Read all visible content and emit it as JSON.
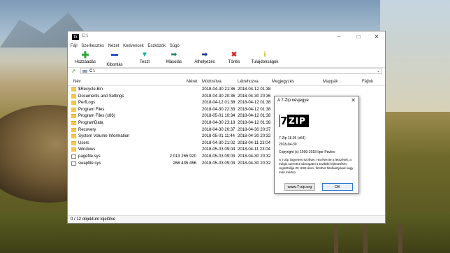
{
  "window": {
    "title": "C:\\",
    "app_icon_text": "7z"
  },
  "menu": [
    "Fájl",
    "Szerkesztés",
    "Nézet",
    "Kedvencek",
    "Eszközök",
    "Súgó"
  ],
  "toolbar": [
    {
      "label": "Hozzáadás",
      "icon": "plus-icon",
      "color": "#2fa93a"
    },
    {
      "label": "Kibontás",
      "icon": "minus-icon",
      "color": "#2b55c9"
    },
    {
      "label": "Teszt",
      "icon": "check-icon",
      "color": "#1aa7a1"
    },
    {
      "label": "Másolás",
      "icon": "copy-arrow-icon",
      "color": "#1f8a6c"
    },
    {
      "label": "Áthelyezés",
      "icon": "move-arrow-icon",
      "color": "#233c9b"
    },
    {
      "label": "Törlés",
      "icon": "delete-x-icon",
      "color": "#d62020"
    },
    {
      "label": "Tulajdonságok",
      "icon": "info-icon",
      "color": "#c9a700"
    }
  ],
  "address": {
    "path": "C:\\"
  },
  "columns": {
    "name": "Név",
    "size": "Méret",
    "modified": "Módosítva",
    "created": "Létrehozva",
    "comment": "Megjegyzés",
    "folders": "Mappák",
    "files": "Fájlok"
  },
  "rows": [
    {
      "name": "$Recycle.Bin",
      "size": "",
      "modified": "2018-04-30 21:36",
      "created": "2018-04-12 01:38",
      "type": "folder"
    },
    {
      "name": "Documents and Settings",
      "size": "",
      "modified": "2018-04-30 20:36",
      "created": "2018-04-30 20:36",
      "type": "folder"
    },
    {
      "name": "PerfLogs",
      "size": "",
      "modified": "2018-04-12 01:38",
      "created": "2018-04-12 01:38",
      "type": "folder"
    },
    {
      "name": "Program Files",
      "size": "",
      "modified": "2018-04-30 22:33",
      "created": "2018-04-12 01:38",
      "type": "folder"
    },
    {
      "name": "Program Files (x86)",
      "size": "",
      "modified": "2018-05-01 10:34",
      "created": "2018-04-12 01:38",
      "type": "folder"
    },
    {
      "name": "ProgramData",
      "size": "",
      "modified": "2018-04-30 23:18",
      "created": "2018-04-12 01:38",
      "type": "folder"
    },
    {
      "name": "Recovery",
      "size": "",
      "modified": "2018-04-30 20:37",
      "created": "2018-04-30 20:37",
      "type": "folder"
    },
    {
      "name": "System Volume Information",
      "size": "",
      "modified": "2018-05-01 11:44",
      "created": "2018-04-30 20:32",
      "type": "folder"
    },
    {
      "name": "Users",
      "size": "",
      "modified": "2018-04-30 21:02",
      "created": "2018-04-11 23:04",
      "type": "folder"
    },
    {
      "name": "Windows",
      "size": "",
      "modified": "2018-05-03 09:04",
      "created": "2018-04-11 23:04",
      "type": "folder"
    },
    {
      "name": "pagefile.sys",
      "size": "2 013 265 920",
      "modified": "2018-05-03 09:03",
      "created": "2018-04-30 20:32",
      "type": "file"
    },
    {
      "name": "swapfile.sys",
      "size": "268 435 456",
      "modified": "2018-05-03 09:03",
      "created": "2018-04-30 20:32",
      "type": "file"
    }
  ],
  "status": "0 / 12 objektum kijelölve",
  "about": {
    "title": "A 7-Zip névjegye",
    "logo_text_seven": "7",
    "logo_text_zip": "ZIP",
    "version": "7-Zip 18.05 (x64)",
    "date": "2018-04-30",
    "copyright": "Copyright (c) 1999-2018 Igor Pavlov",
    "description": "A 7-Zip ingyenes szoftver. Ha élvezte a letszését, a mégis szeretné támogatni a további fejlesztését, regisztrálja 20 USD áron, fizethet hitelkártyával vagy más módon.",
    "website_button": "www.7-zip.org",
    "ok_button": "OK"
  }
}
